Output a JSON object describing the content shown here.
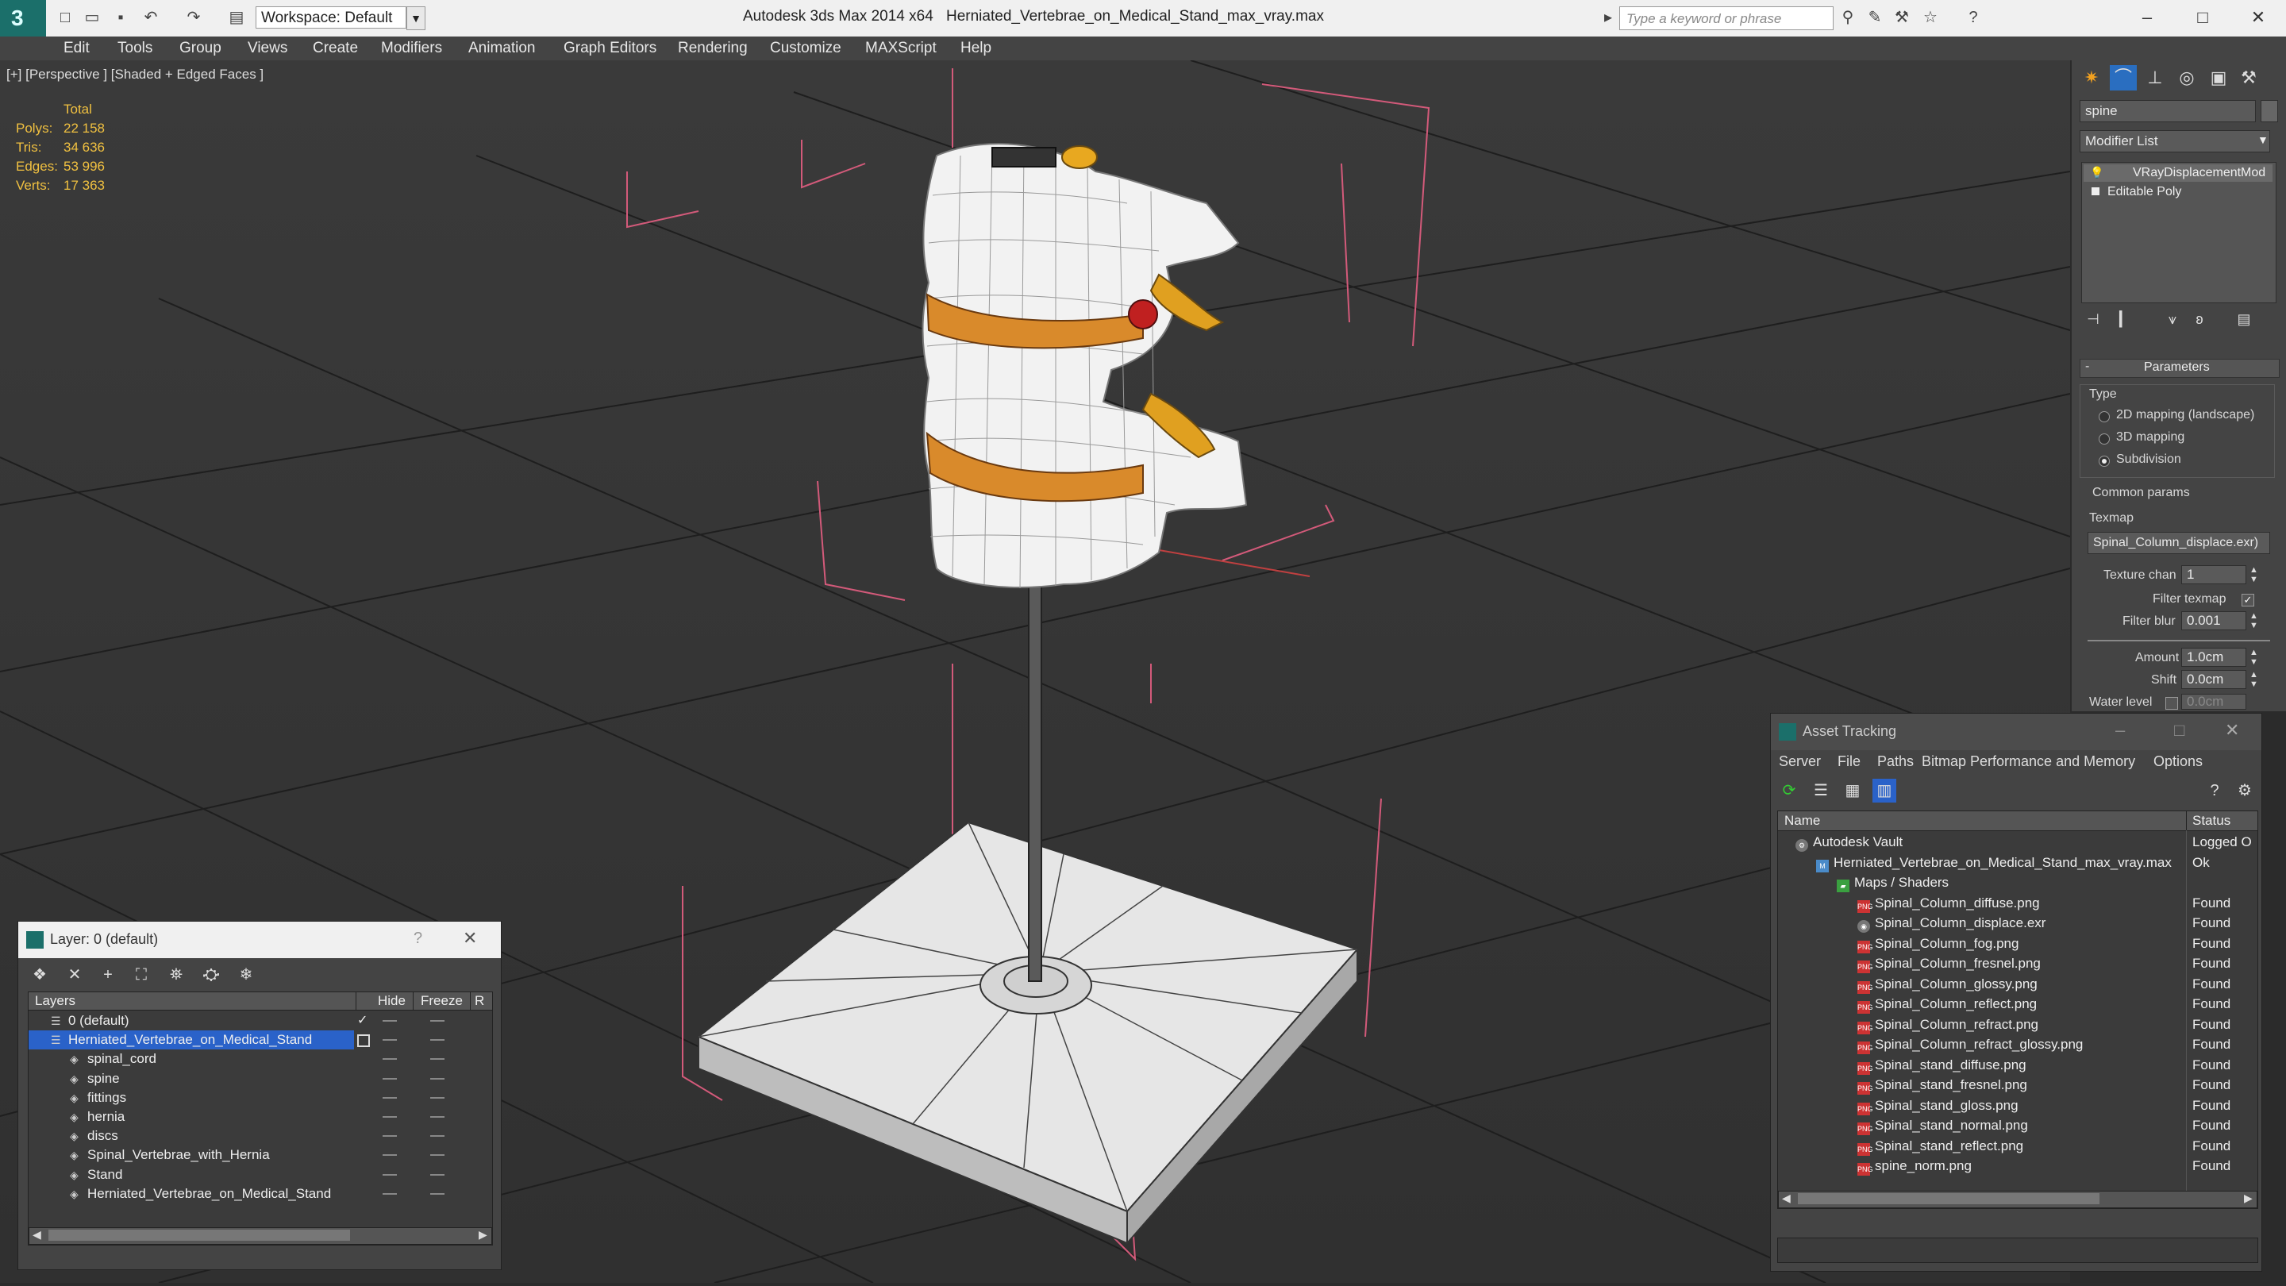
{
  "titlebar": {
    "workspace": "Workspace: Default",
    "app_title": "Autodesk 3ds Max  2014 x64",
    "file_title": "Herniated_Vertebrae_on_Medical_Stand_max_vray.max",
    "search_placeholder": "Type a keyword or phrase"
  },
  "menu": [
    "Edit",
    "Tools",
    "Group",
    "Views",
    "Create",
    "Modifiers",
    "Animation",
    "Graph Editors",
    "Rendering",
    "Customize",
    "MAXScript",
    "Help"
  ],
  "viewport": {
    "label": "[+] [Perspective ] [Shaded + Edged Faces ]",
    "stats_header": "Total",
    "stats": [
      {
        "label": "Polys:",
        "value": "22 158"
      },
      {
        "label": "Tris:",
        "value": "34 636"
      },
      {
        "label": "Edges:",
        "value": "53 996"
      },
      {
        "label": "Verts:",
        "value": "17 363"
      }
    ]
  },
  "command_panel": {
    "object_name": "spine",
    "modifier_list": "Modifier List",
    "stack": [
      "VRayDisplacementMod",
      "Editable Poly"
    ],
    "rollout_title": "Parameters",
    "type_label": "Type",
    "type_options": [
      {
        "label": "2D mapping (landscape)",
        "selected": false
      },
      {
        "label": "3D mapping",
        "selected": false
      },
      {
        "label": "Subdivision",
        "selected": true
      }
    ],
    "common_params": "Common params",
    "texmap_label": "Texmap",
    "texmap_value": "Spinal_Column_displace.exr)",
    "texture_chan_label": "Texture chan",
    "texture_chan_value": "1",
    "filter_texmap_label": "Filter texmap",
    "filter_blur_label": "Filter blur",
    "filter_blur_value": "0.001",
    "amount_label": "Amount",
    "amount_value": "1.0cm",
    "shift_label": "Shift",
    "shift_value": "0.0cm",
    "water_level_label": "Water level",
    "water_level_value": "0.0cm"
  },
  "asset_tracking": {
    "title": "Asset Tracking",
    "menu": [
      "Server",
      "File",
      "Paths",
      "Bitmap Performance and Memory",
      "Options"
    ],
    "col_name": "Name",
    "col_status": "Status",
    "rows": [
      {
        "name": "Autodesk Vault",
        "status": "Logged O",
        "indent": 0,
        "icon": "vault"
      },
      {
        "name": "Herniated_Vertebrae_on_Medical_Stand_max_vray.max",
        "status": "Ok",
        "indent": 1,
        "icon": "max"
      },
      {
        "name": "Maps / Shaders",
        "status": "",
        "indent": 2,
        "icon": "folder"
      },
      {
        "name": "Spinal_Column_diffuse.png",
        "status": "Found",
        "indent": 3,
        "icon": "png"
      },
      {
        "name": "Spinal_Column_displace.exr",
        "status": "Found",
        "indent": 3,
        "icon": "exr"
      },
      {
        "name": "Spinal_Column_fog.png",
        "status": "Found",
        "indent": 3,
        "icon": "png"
      },
      {
        "name": "Spinal_Column_fresnel.png",
        "status": "Found",
        "indent": 3,
        "icon": "png"
      },
      {
        "name": "Spinal_Column_glossy.png",
        "status": "Found",
        "indent": 3,
        "icon": "png"
      },
      {
        "name": "Spinal_Column_reflect.png",
        "status": "Found",
        "indent": 3,
        "icon": "png"
      },
      {
        "name": "Spinal_Column_refract.png",
        "status": "Found",
        "indent": 3,
        "icon": "png"
      },
      {
        "name": "Spinal_Column_refract_glossy.png",
        "status": "Found",
        "indent": 3,
        "icon": "png"
      },
      {
        "name": "Spinal_stand_diffuse.png",
        "status": "Found",
        "indent": 3,
        "icon": "png"
      },
      {
        "name": "Spinal_stand_fresnel.png",
        "status": "Found",
        "indent": 3,
        "icon": "png"
      },
      {
        "name": "Spinal_stand_gloss.png",
        "status": "Found",
        "indent": 3,
        "icon": "png"
      },
      {
        "name": "Spinal_stand_normal.png",
        "status": "Found",
        "indent": 3,
        "icon": "png"
      },
      {
        "name": "Spinal_stand_reflect.png",
        "status": "Found",
        "indent": 3,
        "icon": "png"
      },
      {
        "name": "spine_norm.png",
        "status": "Found",
        "indent": 3,
        "icon": "png"
      }
    ]
  },
  "layer_dialog": {
    "title": "Layer: 0 (default)",
    "help": "?",
    "col_layers": "Layers",
    "col_hide": "Hide",
    "col_freeze": "Freeze",
    "col_r": "R",
    "rows": [
      {
        "name": "0 (default)",
        "indent": 1,
        "selected": false
      },
      {
        "name": "Herniated_Vertebrae_on_Medical_Stand",
        "indent": 1,
        "selected": true
      },
      {
        "name": "spinal_cord",
        "indent": 2,
        "selected": false
      },
      {
        "name": "spine",
        "indent": 2,
        "selected": false
      },
      {
        "name": "fittings",
        "indent": 2,
        "selected": false
      },
      {
        "name": "hernia",
        "indent": 2,
        "selected": false
      },
      {
        "name": "discs",
        "indent": 2,
        "selected": false
      },
      {
        "name": "Spinal_Vertebrae_with_Hernia",
        "indent": 2,
        "selected": false
      },
      {
        "name": "Stand",
        "indent": 2,
        "selected": false
      },
      {
        "name": "Herniated_Vertebrae_on_Medical_Stand",
        "indent": 2,
        "selected": false
      }
    ]
  },
  "colors": {
    "accent": "#1a6fc9",
    "selection": "#2a62c9",
    "stat": "#f0c040",
    "bone": "#f2f2f2",
    "disc": "#d98a2b"
  }
}
